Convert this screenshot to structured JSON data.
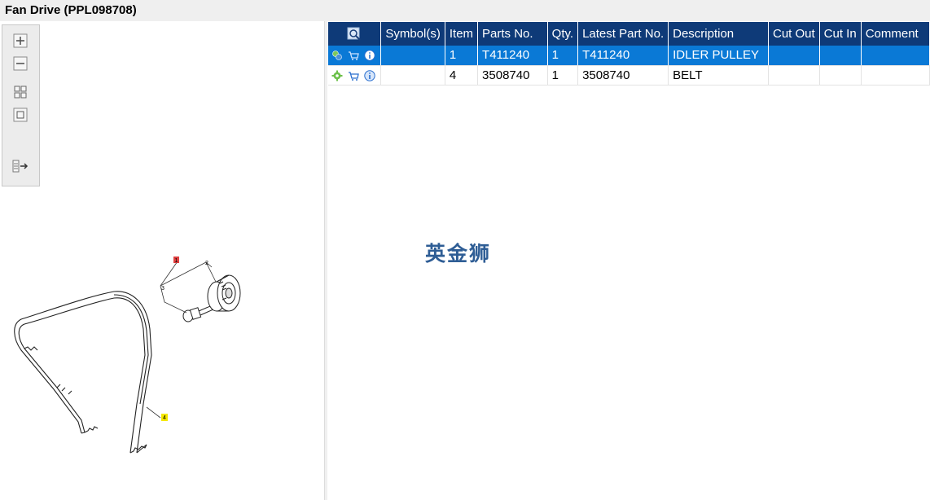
{
  "window": {
    "title": "Fan Drive (PPL098708)"
  },
  "toolbar": {
    "buttons": [
      {
        "name": "zoom-in",
        "icon": "plus-icon"
      },
      {
        "name": "zoom-out",
        "icon": "minus-icon"
      },
      {
        "name": "fit-all",
        "icon": "grid-icon"
      },
      {
        "name": "reset-view",
        "icon": "square-icon"
      },
      {
        "name": "toggle-list",
        "icon": "list-arrow-icon"
      }
    ]
  },
  "drawing": {
    "callouts": [
      {
        "label": "1",
        "highlight": "#e04040"
      },
      {
        "label": "2",
        "highlight": ""
      },
      {
        "label": "3",
        "highlight": ""
      },
      {
        "label": "4",
        "highlight": "#f5e800"
      }
    ]
  },
  "table": {
    "headers": {
      "symbols": "Symbol(s)",
      "item": "Item",
      "parts_no": "Parts No.",
      "qty": "Qty.",
      "latest_part_no": "Latest Part No.",
      "description": "Description",
      "cut_out": "Cut Out",
      "cut_in": "Cut In",
      "comment": "Comment"
    },
    "rows": [
      {
        "symbols": "",
        "item": "1",
        "parts_no": "T411240",
        "qty": "1",
        "latest_part_no": "T411240",
        "description": "IDLER PULLEY",
        "cut_out": "",
        "cut_in": "",
        "comment": "",
        "selected": true
      },
      {
        "symbols": "",
        "item": "4",
        "parts_no": "3508740",
        "qty": "1",
        "latest_part_no": "3508740",
        "description": "BELT",
        "cut_out": "",
        "cut_in": "",
        "comment": "",
        "selected": false
      }
    ]
  },
  "watermark": {
    "text": "英金狮"
  },
  "colors": {
    "header_bg": "#0e3a78",
    "selected_row": "#0a79d6",
    "watermark": "#2e5d95"
  }
}
